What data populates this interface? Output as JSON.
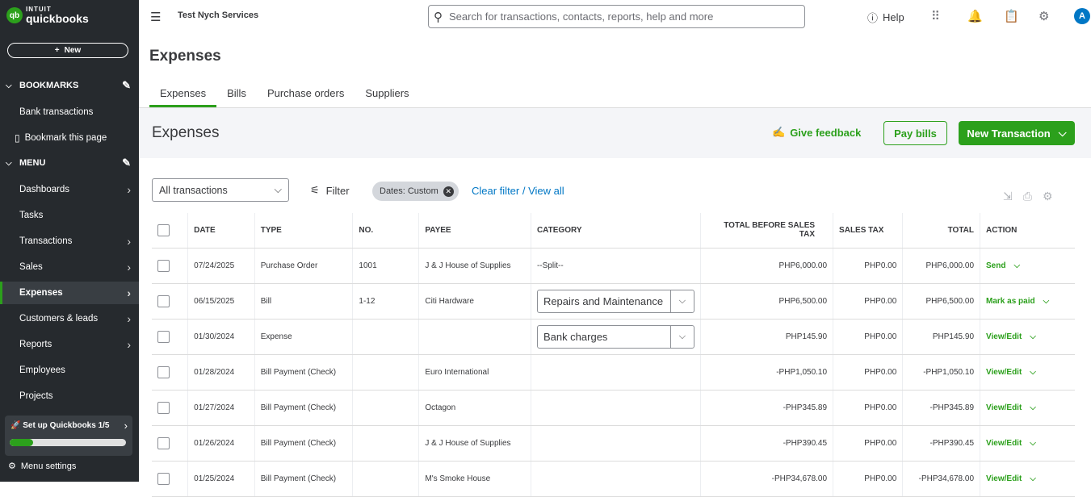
{
  "logo": {
    "line1": "INTUIT",
    "line2": "quickbooks",
    "mark": "qb"
  },
  "sidebar": {
    "new_label": "New",
    "bookmarks_title": "BOOKMARKS",
    "bookmarks": [
      {
        "label": "Bank transactions"
      },
      {
        "label": "Bookmark this page"
      }
    ],
    "menu_title": "MENU",
    "items": [
      {
        "label": "Dashboards"
      },
      {
        "label": "Tasks"
      },
      {
        "label": "Transactions"
      },
      {
        "label": "Sales"
      },
      {
        "label": "Expenses"
      },
      {
        "label": "Customers & leads"
      },
      {
        "label": "Reports"
      },
      {
        "label": "Employees"
      },
      {
        "label": "Projects"
      }
    ],
    "active_item": "Expenses",
    "setup": {
      "label": "Set up Quickbooks 1/5",
      "progress": 0.2
    },
    "menu_settings": "Menu settings"
  },
  "topbar": {
    "company": "Test Nych Services",
    "search_placeholder": "Search for transactions, contacts, reports, help and more",
    "help_label": "Help",
    "avatar_letter": "A"
  },
  "page": {
    "title": "Expenses",
    "tabs": [
      {
        "label": "Expenses"
      },
      {
        "label": "Bills"
      },
      {
        "label": "Purchase orders"
      },
      {
        "label": "Suppliers"
      }
    ],
    "active_tab": "Expenses",
    "band_title": "Expenses",
    "give_feedback": "Give feedback",
    "pay_bills": "Pay bills",
    "new_transaction": "New Transaction"
  },
  "filters": {
    "selected": "All transactions",
    "filter_label": "Filter",
    "chip_label": "Dates: Custom",
    "clear_label": "Clear filter / View all"
  },
  "table": {
    "headers": [
      "DATE",
      "TYPE",
      "NO.",
      "PAYEE",
      "CATEGORY",
      "TOTAL BEFORE SALES TAX",
      "SALES TAX",
      "TOTAL",
      "ACTION"
    ],
    "rows": [
      {
        "date": "07/24/2025",
        "type": "Purchase Order",
        "no": "1001",
        "payee": "J & J House of Supplies",
        "category": "--Split--",
        "category_select": false,
        "before_tax": "PHP6,000.00",
        "tax": "PHP0.00",
        "total": "PHP6,000.00",
        "action": "Send"
      },
      {
        "date": "06/15/2025",
        "type": "Bill",
        "no": "1-12",
        "payee": "Citi Hardware",
        "category": "Repairs and Maintenance",
        "category_select": true,
        "before_tax": "PHP6,500.00",
        "tax": "PHP0.00",
        "total": "PHP6,500.00",
        "action": "Mark as paid"
      },
      {
        "date": "01/30/2024",
        "type": "Expense",
        "no": "",
        "payee": "",
        "category": "Bank charges",
        "category_select": true,
        "before_tax": "PHP145.90",
        "tax": "PHP0.00",
        "total": "PHP145.90",
        "action": "View/Edit"
      },
      {
        "date": "01/28/2024",
        "type": "Bill Payment (Check)",
        "no": "",
        "payee": "Euro International",
        "category": "",
        "category_select": false,
        "before_tax": "-PHP1,050.10",
        "tax": "PHP0.00",
        "total": "-PHP1,050.10",
        "action": "View/Edit"
      },
      {
        "date": "01/27/2024",
        "type": "Bill Payment (Check)",
        "no": "",
        "payee": "Octagon",
        "category": "",
        "category_select": false,
        "before_tax": "-PHP345.89",
        "tax": "PHP0.00",
        "total": "-PHP345.89",
        "action": "View/Edit"
      },
      {
        "date": "01/26/2024",
        "type": "Bill Payment (Check)",
        "no": "",
        "payee": "J & J House of Supplies",
        "category": "",
        "category_select": false,
        "before_tax": "-PHP390.45",
        "tax": "PHP0.00",
        "total": "-PHP390.45",
        "action": "View/Edit"
      },
      {
        "date": "01/25/2024",
        "type": "Bill Payment (Check)",
        "no": "",
        "payee": "M's Smoke House",
        "category": "",
        "category_select": false,
        "before_tax": "-PHP34,678.00",
        "tax": "PHP0.00",
        "total": "-PHP34,678.00",
        "action": "View/Edit"
      }
    ]
  },
  "colors": {
    "brand_green": "#2ca01c",
    "sidebar_bg": "#262a2e",
    "link_blue": "#0077c5"
  }
}
